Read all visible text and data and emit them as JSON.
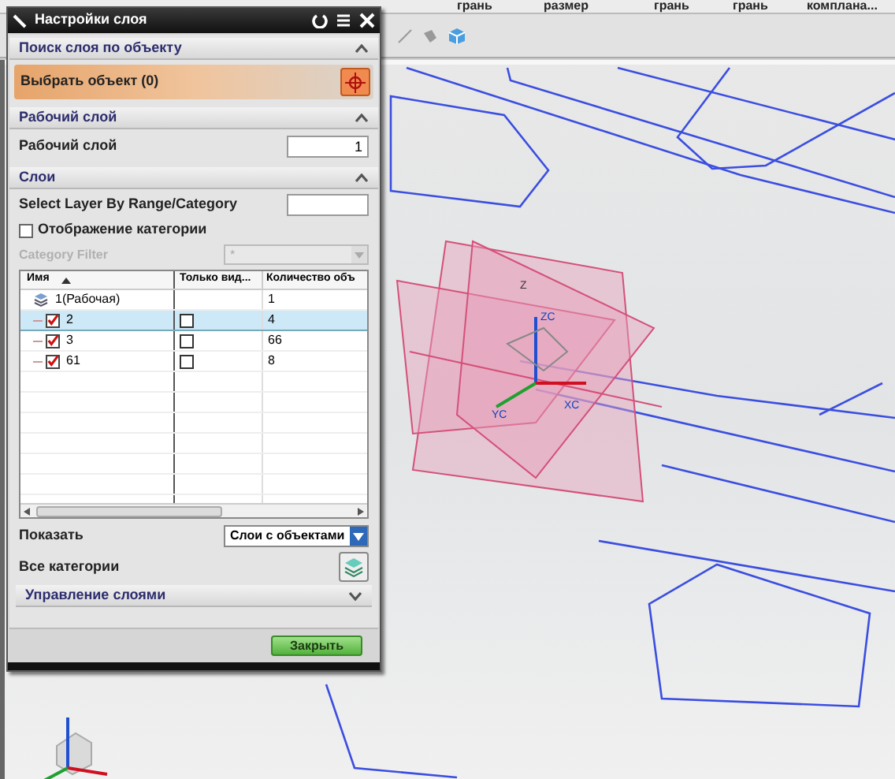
{
  "top_labels": [
    "грань",
    "размер",
    "грань",
    "грань",
    "комплана..."
  ],
  "dialog": {
    "title": "Настройки слоя",
    "sections": [
      {
        "kind": "select_object",
        "title": "Поиск слоя по объекту",
        "expanded": true,
        "label": "Выбрать объект (0)"
      },
      {
        "kind": "work_layer",
        "title": "Рабочий слой",
        "expanded": true,
        "label": "Рабочий слой",
        "value": "1"
      },
      {
        "kind": "layers",
        "title": "Слои",
        "expanded": true
      }
    ],
    "range_label": "Select Layer By Range/Category",
    "category_display": {
      "label": "Отображение категории",
      "checked": false
    },
    "category_filter": {
      "label": "Category Filter",
      "value": "*",
      "disabled": true
    },
    "table": {
      "columns": [
        "Имя",
        "Только вид...",
        "Количество объ"
      ],
      "rows": [
        {
          "kind": "work",
          "name": "1(Рабочая)",
          "count": "1",
          "selected": false
        },
        {
          "kind": "layer",
          "name": "2",
          "checked": true,
          "visible_only": false,
          "count": "4",
          "selected": true
        },
        {
          "kind": "layer",
          "name": "3",
          "checked": true,
          "visible_only": false,
          "count": "66",
          "selected": false
        },
        {
          "kind": "layer",
          "name": "61",
          "checked": true,
          "visible_only": false,
          "count": "8",
          "selected": false
        }
      ]
    },
    "show": {
      "label": "Показать",
      "value": "Слои с объектами"
    },
    "all_categories": "Все категории",
    "layer_management": {
      "title": "Управление слоями",
      "expanded": false
    },
    "close_button": "Закрыть"
  },
  "axis_labels": [
    "Z",
    "ZC",
    "XC",
    "YC"
  ]
}
